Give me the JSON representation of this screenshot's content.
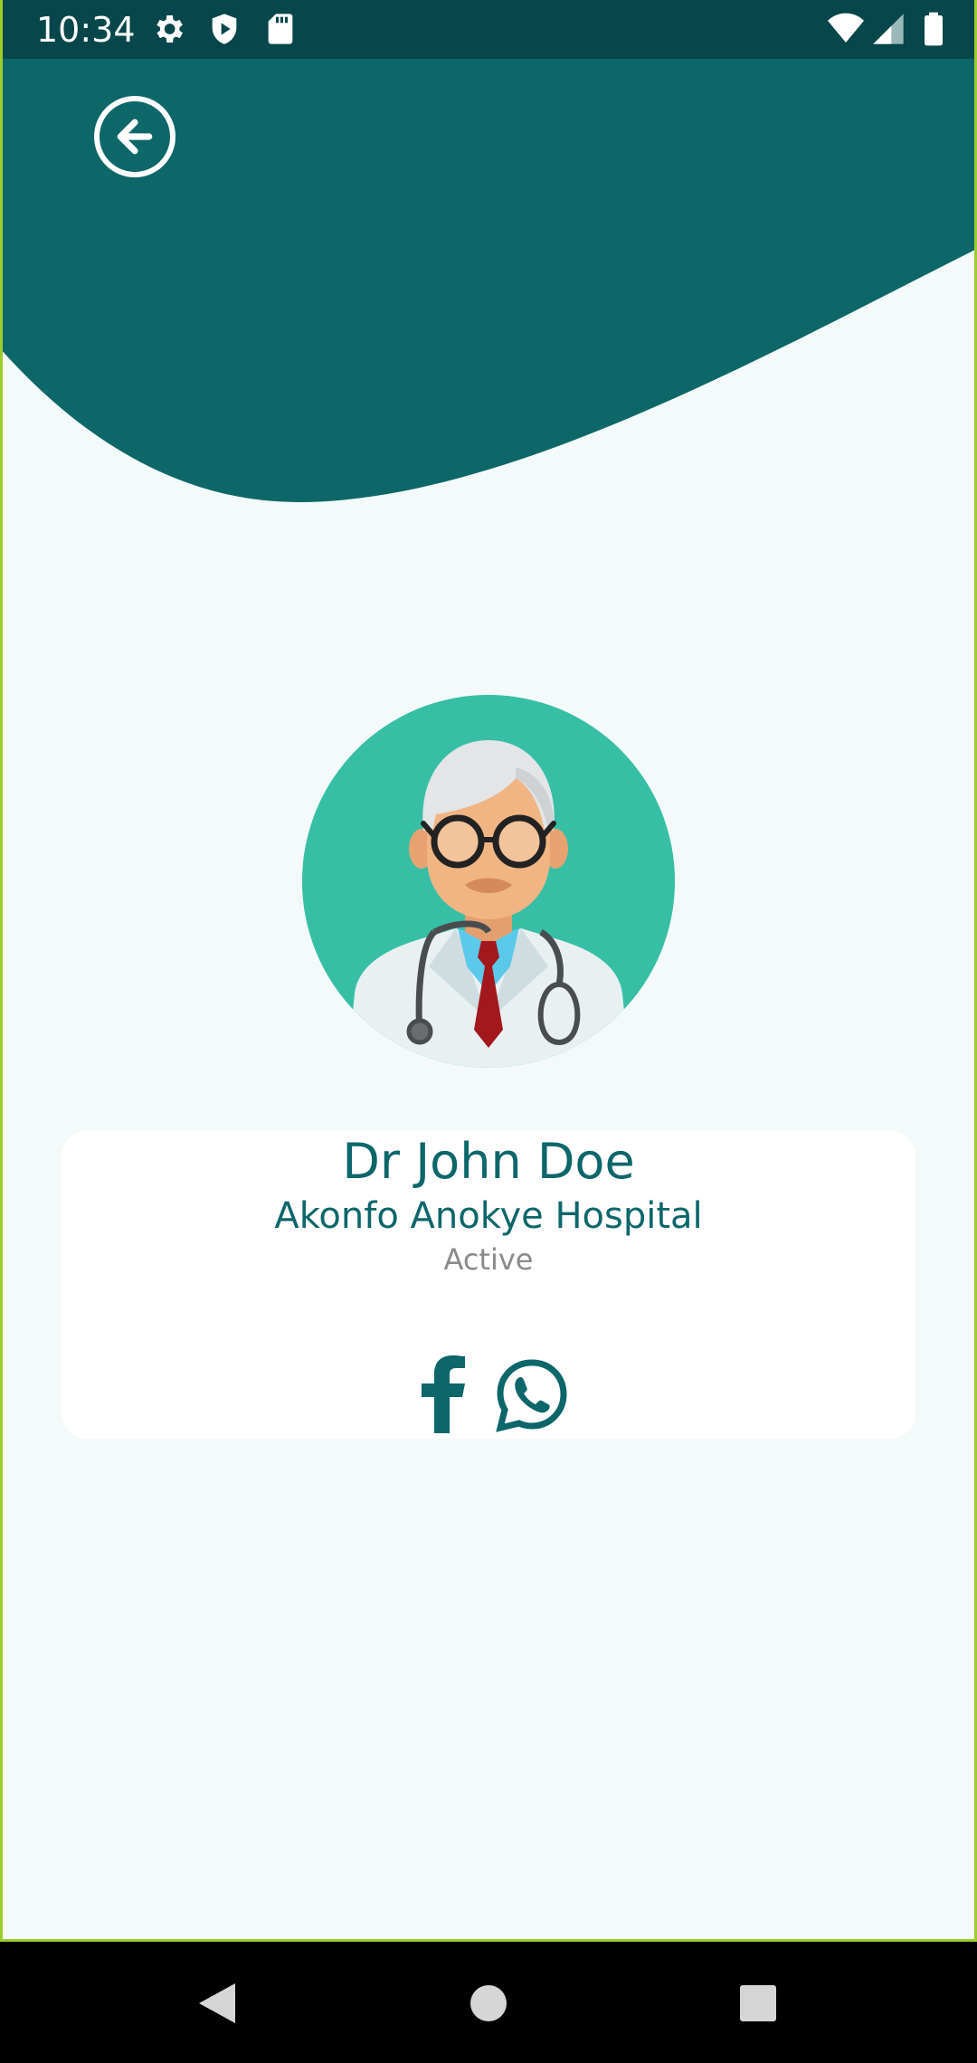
{
  "status_bar": {
    "time": "10:34",
    "icons": [
      "settings-icon",
      "shield-play-icon",
      "sd-card-icon",
      "wifi-icon",
      "signal-icon",
      "battery-icon"
    ]
  },
  "header": {
    "back_icon": "arrow-left-circle-icon",
    "color": "#0d6769"
  },
  "profile": {
    "name": "Dr John Doe",
    "hospital": "Akonfo Anokye Hospital",
    "status": "Active",
    "avatar_icon": "doctor-avatar-icon"
  },
  "social": {
    "facebook_icon": "facebook-icon",
    "whatsapp_icon": "whatsapp-icon"
  },
  "nav_bar": {
    "back_icon": "nav-back-icon",
    "home_icon": "nav-home-icon",
    "recents_icon": "nav-recents-icon"
  },
  "colors": {
    "primary": "#0d6769",
    "status_bar": "#07464a",
    "background": "#f3faf9",
    "avatar_bg": "#37bfa6",
    "muted_text": "#8a8a8a"
  }
}
